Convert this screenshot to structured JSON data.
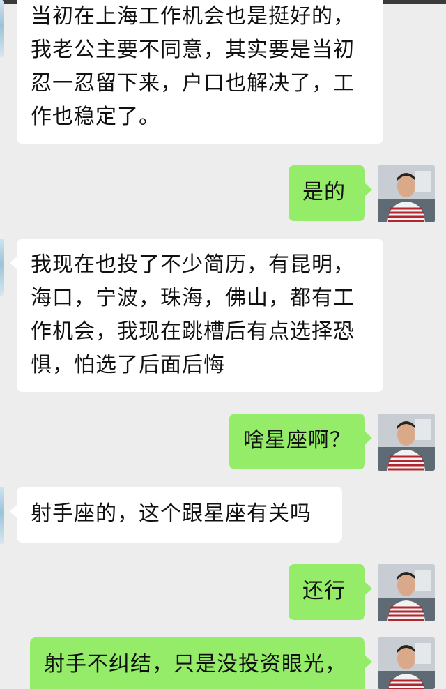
{
  "messages": [
    {
      "side": "in",
      "text": "当初在上海工作机会也是挺好的，\n我老公主要不同意，其实要是当初\n忍一忍留下来，户口也解决了，工\n作也稳定了。"
    },
    {
      "side": "out",
      "text": "是的",
      "avatar_icon": "user-avatar"
    },
    {
      "side": "in",
      "text": "我现在也投了不少简历，有昆明，\n海口，宁波，珠海，佛山，都有工\n作机会，我现在跳槽后有点选择恐\n惧，怕选了后面后悔"
    },
    {
      "side": "out",
      "text": "啥星座啊？",
      "avatar_icon": "user-avatar"
    },
    {
      "side": "in",
      "text": "射手座的，这个跟星座有关吗"
    },
    {
      "side": "out",
      "text": "还行",
      "avatar_icon": "user-avatar"
    },
    {
      "side": "out",
      "text": "射手不纠结，只是没投资眼光，",
      "avatar_icon": "user-avatar"
    }
  ],
  "colors": {
    "background": "#ededed",
    "incoming_bubble": "#ffffff",
    "outgoing_bubble": "#95ec69",
    "text": "#111111"
  }
}
